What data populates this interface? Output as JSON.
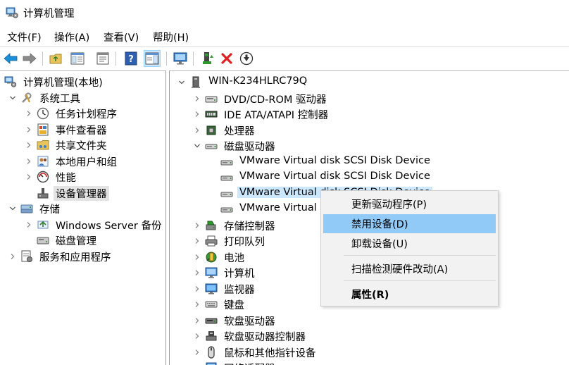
{
  "window": {
    "title": "计算机管理",
    "icon": "computer-management-icon"
  },
  "menu": [
    "文件(F)",
    "操作(A)",
    "查看(V)",
    "帮助(H)"
  ],
  "toolbar": {
    "buttons": [
      "back-arrow-icon",
      "forward-arrow-icon",
      "up-folder-icon",
      "show-hide-console-tree-icon",
      "properties-icon",
      "help-icon",
      "action-pane-icon",
      "computer-monitor-icon",
      "update-driver-icon",
      "uninstall-x-icon",
      "download-arrow-icon"
    ]
  },
  "left_tree": [
    {
      "label": "计算机管理(本地)",
      "level": 0,
      "expander": "",
      "icon": "computer-management-icon"
    },
    {
      "label": "系统工具",
      "level": 1,
      "expander": "expanded",
      "icon": "tools-icon"
    },
    {
      "label": "任务计划程序",
      "level": 2,
      "expander": "collapsed",
      "icon": "clock-icon"
    },
    {
      "label": "事件查看器",
      "level": 2,
      "expander": "collapsed",
      "icon": "event-viewer-icon"
    },
    {
      "label": "共享文件夹",
      "level": 2,
      "expander": "collapsed",
      "icon": "shared-folder-icon"
    },
    {
      "label": "本地用户和组",
      "level": 2,
      "expander": "collapsed",
      "icon": "users-icon"
    },
    {
      "label": "性能",
      "level": 2,
      "expander": "collapsed",
      "icon": "performance-icon"
    },
    {
      "label": "设备管理器",
      "level": 2,
      "expander": "",
      "icon": "device-manager-icon",
      "selected": true
    },
    {
      "label": "存储",
      "level": 1,
      "expander": "expanded",
      "icon": "storage-icon"
    },
    {
      "label": "Windows Server 备份",
      "level": 2,
      "expander": "collapsed",
      "icon": "backup-icon"
    },
    {
      "label": "磁盘管理",
      "level": 2,
      "expander": "",
      "icon": "disk-management-icon"
    },
    {
      "label": "服务和应用程序",
      "level": 1,
      "expander": "collapsed",
      "icon": "services-icon"
    }
  ],
  "right_tree": [
    {
      "label": "WIN-K234HLRC79Q",
      "level": 0,
      "expander": "expanded",
      "icon": "computer-tower-icon"
    },
    {
      "label": "DVD/CD-ROM 驱动器",
      "level": 1,
      "expander": "collapsed",
      "icon": "dvd-drive-icon"
    },
    {
      "label": "IDE ATA/ATAPI 控制器",
      "level": 1,
      "expander": "collapsed",
      "icon": "ide-controller-icon"
    },
    {
      "label": "处理器",
      "level": 1,
      "expander": "collapsed",
      "icon": "processor-icon"
    },
    {
      "label": "磁盘驱动器",
      "level": 1,
      "expander": "expanded",
      "icon": "disk-drive-icon"
    },
    {
      "label": "VMware Virtual disk SCSI Disk Device",
      "level": 2,
      "expander": "",
      "icon": "disk-drive-icon"
    },
    {
      "label": "VMware Virtual disk SCSI Disk Device",
      "level": 2,
      "expander": "",
      "icon": "disk-drive-icon"
    },
    {
      "label": "VMware Virtual disk SCSI Disk Device",
      "level": 2,
      "expander": "",
      "icon": "disk-drive-icon",
      "highlighted": true
    },
    {
      "label": "VMware Virtual d",
      "level": 2,
      "expander": "",
      "icon": "disk-drive-icon"
    },
    {
      "label": "存储控制器",
      "level": 1,
      "expander": "collapsed",
      "icon": "storage-controller-icon"
    },
    {
      "label": "打印队列",
      "level": 1,
      "expander": "collapsed",
      "icon": "printer-icon"
    },
    {
      "label": "电池",
      "level": 1,
      "expander": "collapsed",
      "icon": "battery-icon"
    },
    {
      "label": "计算机",
      "level": 1,
      "expander": "collapsed",
      "icon": "computer-monitor-icon"
    },
    {
      "label": "监视器",
      "level": 1,
      "expander": "collapsed",
      "icon": "monitor-icon"
    },
    {
      "label": "键盘",
      "level": 1,
      "expander": "collapsed",
      "icon": "keyboard-icon"
    },
    {
      "label": "软盘驱动器",
      "level": 1,
      "expander": "collapsed",
      "icon": "floppy-drive-icon"
    },
    {
      "label": "软盘驱动器控制器",
      "level": 1,
      "expander": "collapsed",
      "icon": "floppy-controller-icon"
    },
    {
      "label": "鼠标和其他指针设备",
      "level": 1,
      "expander": "collapsed",
      "icon": "mouse-icon"
    },
    {
      "label": "网络适配器",
      "level": 1,
      "expander": "collapsed",
      "icon": "network-adapter-icon"
    }
  ],
  "context_menu": {
    "items": [
      {
        "label": "更新驱动程序(P)",
        "active": false,
        "bold": false
      },
      {
        "label": "禁用设备(D)",
        "active": true,
        "bold": false
      },
      {
        "label": "卸载设备(U)",
        "active": false,
        "bold": false
      },
      {
        "label": "扫描检测硬件改动(A)",
        "active": false,
        "bold": false
      },
      {
        "label": "属性(R)",
        "active": false,
        "bold": true
      }
    ]
  },
  "colors": {
    "selection": "#e3e3e3",
    "highlight": "#cce8ff",
    "menu_active": "#91c9f7",
    "menu_bg": "#f2f2f2"
  }
}
